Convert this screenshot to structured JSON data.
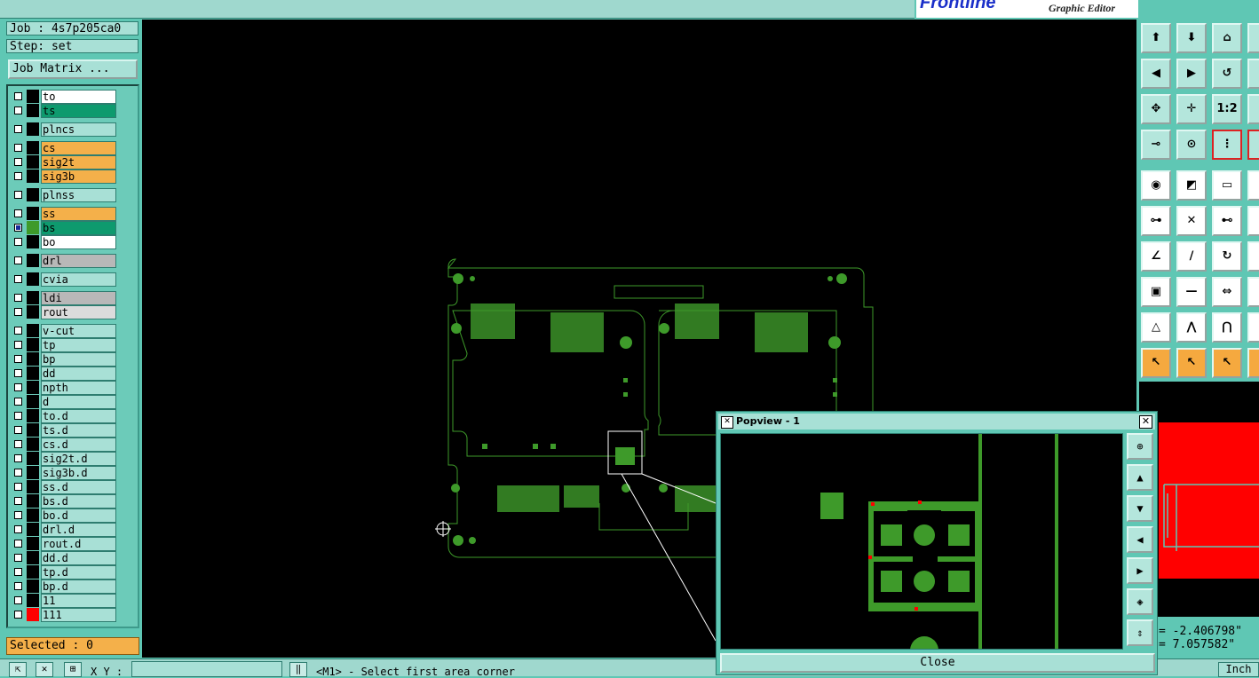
{
  "brand": {
    "logo_main": "Frontline",
    "subtitle": "Graphic Editor"
  },
  "info": {
    "job": "Job : 4s7p205ca0",
    "step": "Step: set"
  },
  "job_matrix_label": "Job Matrix ...",
  "layers": [
    {
      "name": "to",
      "color": "#ffffff",
      "swatch": "#000000",
      "checked": false
    },
    {
      "name": "ts",
      "color": "#0e9a6e",
      "swatch": "#000000",
      "checked": false
    },
    {
      "name": "plncs",
      "color": "#a8e0d6",
      "swatch": "#000000",
      "checked": false,
      "gap": true
    },
    {
      "name": "cs",
      "color": "#f4b04a",
      "swatch": "#000000",
      "checked": false,
      "gap": true
    },
    {
      "name": "sig2t",
      "color": "#f4b04a",
      "swatch": "#000000",
      "checked": false
    },
    {
      "name": "sig3b",
      "color": "#f4b04a",
      "swatch": "#000000",
      "checked": false
    },
    {
      "name": "plnss",
      "color": "#a8e0d6",
      "swatch": "#000000",
      "checked": false,
      "gap": true
    },
    {
      "name": "ss",
      "color": "#f4b04a",
      "swatch": "#000000",
      "checked": false,
      "gap": true
    },
    {
      "name": "bs",
      "color": "#0e9a6e",
      "swatch": "#3e9a2a",
      "checked": true,
      "tag": "⊞"
    },
    {
      "name": "bo",
      "color": "#ffffff",
      "swatch": "#000000",
      "checked": false
    },
    {
      "name": "drl",
      "color": "#b8b8b8",
      "swatch": "#000000",
      "checked": false,
      "gap": true
    },
    {
      "name": "cvia",
      "color": "#a8e0d6",
      "swatch": "#000000",
      "checked": false,
      "gap": true
    },
    {
      "name": "ldi",
      "color": "#b8b8b8",
      "swatch": "#000000",
      "checked": false,
      "gap": true
    },
    {
      "name": "rout",
      "color": "#dcdcdc",
      "swatch": "#000000",
      "checked": false
    },
    {
      "name": "v-cut",
      "color": "#a8e0d6",
      "swatch": "#000000",
      "checked": false,
      "gap": true
    },
    {
      "name": "tp",
      "color": "#a8e0d6",
      "swatch": "#000000",
      "checked": false
    },
    {
      "name": "bp",
      "color": "#a8e0d6",
      "swatch": "#000000",
      "checked": false
    },
    {
      "name": "dd",
      "color": "#a8e0d6",
      "swatch": "#000000",
      "checked": false
    },
    {
      "name": "npth",
      "color": "#a8e0d6",
      "swatch": "#000000",
      "checked": false
    },
    {
      "name": "d",
      "color": "#a8e0d6",
      "swatch": "#000000",
      "checked": false
    },
    {
      "name": "to.d",
      "color": "#a8e0d6",
      "swatch": "#000000",
      "checked": false,
      "tag": "↙"
    },
    {
      "name": "ts.d",
      "color": "#a8e0d6",
      "swatch": "#000000",
      "checked": false,
      "tag": "↙"
    },
    {
      "name": "cs.d",
      "color": "#a8e0d6",
      "swatch": "#000000",
      "checked": false,
      "tag": "↙"
    },
    {
      "name": "sig2t.d",
      "color": "#a8e0d6",
      "swatch": "#000000",
      "checked": false,
      "tag": "↙"
    },
    {
      "name": "sig3b.d",
      "color": "#a8e0d6",
      "swatch": "#000000",
      "checked": false,
      "tag": "↙"
    },
    {
      "name": "ss.d",
      "color": "#a8e0d6",
      "swatch": "#000000",
      "checked": false,
      "tag": "↙"
    },
    {
      "name": "bs.d",
      "color": "#a8e0d6",
      "swatch": "#000000",
      "checked": false,
      "tag": "↙"
    },
    {
      "name": "bo.d",
      "color": "#a8e0d6",
      "swatch": "#000000",
      "checked": false,
      "tag": "↙"
    },
    {
      "name": "drl.d",
      "color": "#a8e0d6",
      "swatch": "#000000",
      "checked": false
    },
    {
      "name": "rout.d",
      "color": "#a8e0d6",
      "swatch": "#000000",
      "checked": false
    },
    {
      "name": "dd.d",
      "color": "#a8e0d6",
      "swatch": "#000000",
      "checked": false,
      "tag": "↙"
    },
    {
      "name": "tp.d",
      "color": "#a8e0d6",
      "swatch": "#000000",
      "checked": false
    },
    {
      "name": "bp.d",
      "color": "#a8e0d6",
      "swatch": "#000000",
      "checked": false
    },
    {
      "name": "11",
      "color": "#a8e0d6",
      "swatch": "#000000",
      "checked": false
    },
    {
      "name": "111",
      "color": "#a8e0d6",
      "swatch": "#ff0000",
      "checked": false
    }
  ],
  "selected_label": "Selected : 0",
  "status_bar": {
    "xy_label": "X Y :",
    "prompt": "<M1> - Select first area corner"
  },
  "coords": {
    "x": "= -2.406798\"",
    "y": "= 7.057582\""
  },
  "units": "Inch",
  "popview": {
    "title": "Popview - 1",
    "close_label": "Close"
  },
  "colors": {
    "board": "#3e9a2a",
    "background": "#000000",
    "panel": "#5fc7b4",
    "button": "#a8e0d6",
    "highlight": "#f4b04a"
  }
}
